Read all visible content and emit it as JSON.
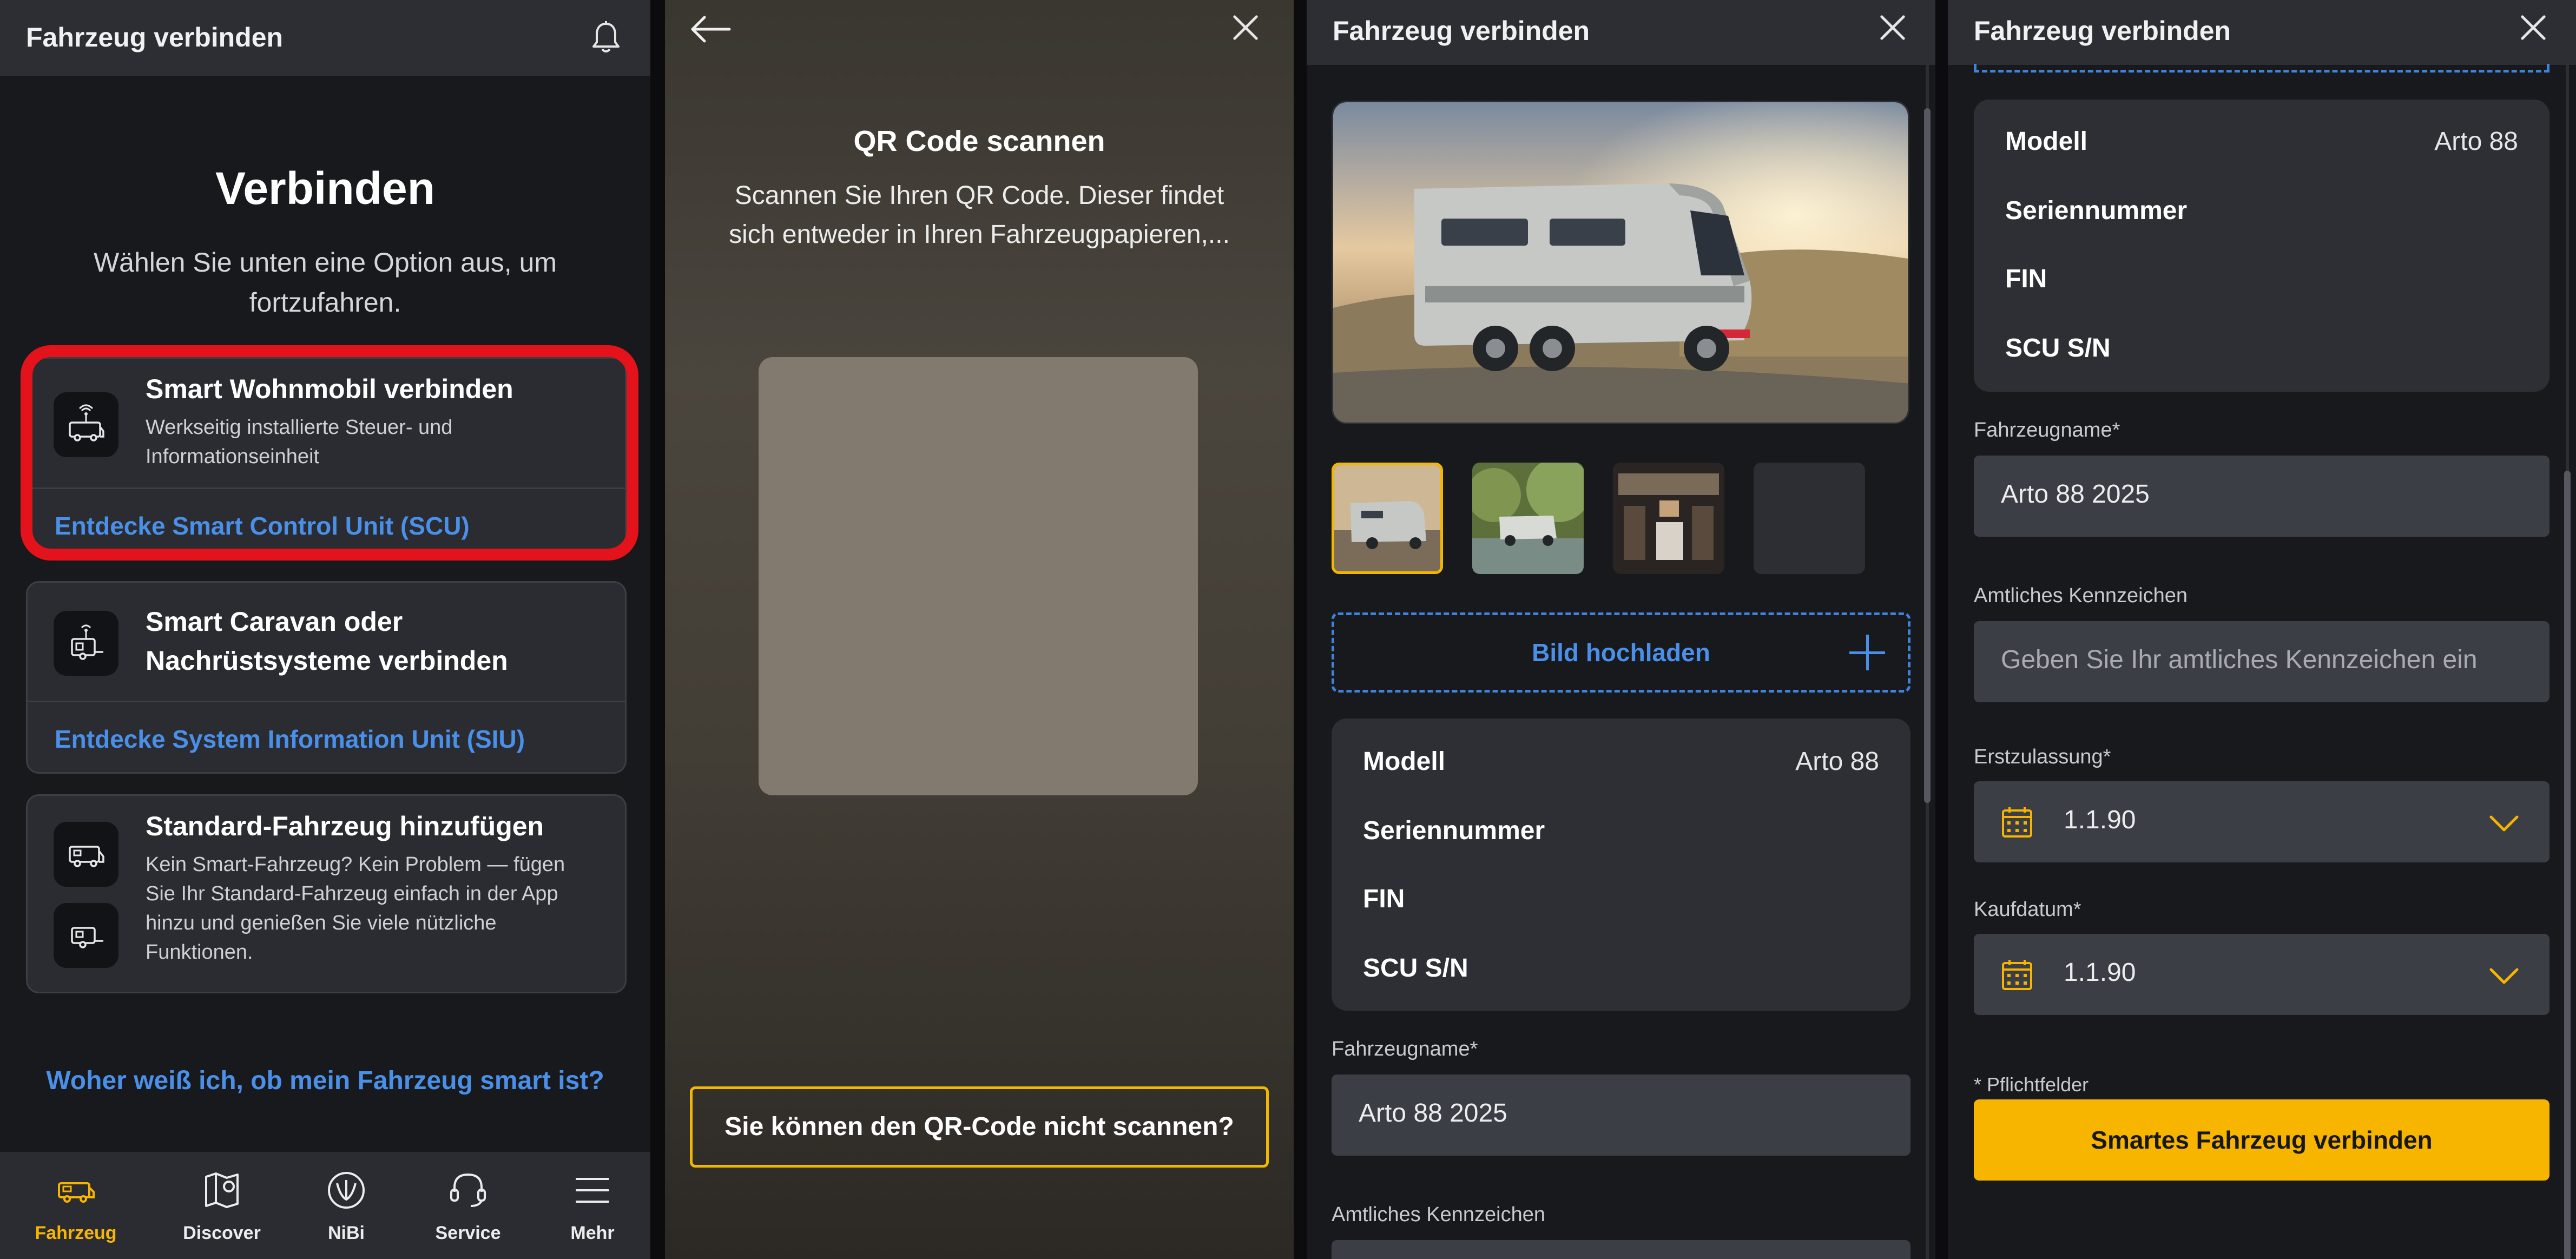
{
  "screen1": {
    "header_title": "Fahrzeug verbinden",
    "heading": "Verbinden",
    "subheading": "Wählen Sie unten eine Option aus, um fortzufahren.",
    "cards": [
      {
        "title": "Smart Wohnmobil verbinden",
        "description": "Werkseitig installierte Steuer- und Informationseinheit",
        "link": "Entdecke Smart Control Unit (SCU)"
      },
      {
        "title": "Smart Caravan oder Nachrüstsysteme verbinden",
        "link": "Entdecke System Information Unit (SIU)"
      },
      {
        "title": "Standard-Fahrzeug hinzufügen",
        "description": "Kein Smart-Fahrzeug? Kein Problem — fügen Sie Ihr Standard-Fahrzeug einfach in der App hinzu und genießen Sie viele nützliche Funktionen."
      }
    ],
    "smart_question": "Woher weiß ich, ob mein Fahrzeug smart ist?",
    "nav": [
      {
        "label": "Fahrzeug",
        "icon": "motorhome-icon",
        "active": true
      },
      {
        "label": "Discover",
        "icon": "map-pin-icon",
        "active": false
      },
      {
        "label": "NiBi",
        "icon": "nibi-icon",
        "active": false
      },
      {
        "label": "Service",
        "icon": "headset-icon",
        "active": false
      },
      {
        "label": "Mehr",
        "icon": "menu-icon",
        "active": false
      }
    ],
    "colors": {
      "accent": "#f7b500",
      "link": "#4a8fe8",
      "highlight": "#e3121b"
    }
  },
  "screen2": {
    "title": "QR Code scannen",
    "description": "Scannen Sie Ihren QR Code. Dieser findet sich entweder in Ihren Fahrzeugpapieren,...",
    "help_button": "Sie können den QR-Code nicht scannen?"
  },
  "screen3": {
    "header_title": "Fahrzeug verbinden",
    "upload_label": "Bild hochladen",
    "info": [
      {
        "key": "Modell",
        "value": "Arto 88"
      },
      {
        "key": "Seriennummer",
        "value": ""
      },
      {
        "key": "FIN",
        "value": ""
      },
      {
        "key": "SCU S/N",
        "value": ""
      }
    ],
    "vehicle_name_label": "Fahrzeugname*",
    "vehicle_name_value": "Arto 88 2025",
    "plate_label": "Amtliches Kennzeichen"
  },
  "screen4": {
    "header_title": "Fahrzeug verbinden",
    "info": [
      {
        "key": "Modell",
        "value": "Arto 88"
      },
      {
        "key": "Seriennummer",
        "value": ""
      },
      {
        "key": "FIN",
        "value": ""
      },
      {
        "key": "SCU S/N",
        "value": ""
      }
    ],
    "vehicle_name_label": "Fahrzeugname*",
    "vehicle_name_value": "Arto 88 2025",
    "plate_label": "Amtliches Kennzeichen",
    "plate_placeholder": "Geben Sie Ihr amtliches Kennzeichen ein",
    "registration_label": "Erstzulassung*",
    "registration_value": "1.1.90",
    "purchase_label": "Kaufdatum*",
    "purchase_value": "1.1.90",
    "required_note": "* Pflichtfelder",
    "submit_button": "Smartes Fahrzeug verbinden"
  }
}
